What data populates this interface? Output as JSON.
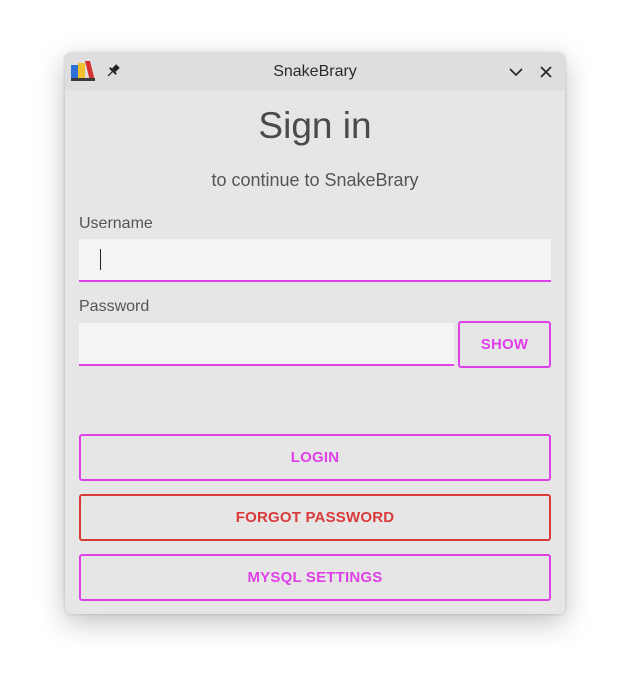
{
  "window": {
    "title": "SnakeBrary"
  },
  "signin": {
    "heading": "Sign in",
    "subheading": "to continue to SnakeBrary"
  },
  "username": {
    "label": "Username",
    "value": "",
    "placeholder": ""
  },
  "password": {
    "label": "Password",
    "value": "",
    "placeholder": "",
    "show_label": "SHOW"
  },
  "actions": {
    "login_label": "LOGIN",
    "forgot_label": "FORGOT PASSWORD",
    "mysql_label": "MYSQL SETTINGS"
  },
  "colors": {
    "accent": "#e040e8",
    "danger": "#d93a3a",
    "background": "#e6e6e6",
    "input_bg": "#f4f4f4"
  },
  "icons": {
    "app": "app-logo-icon",
    "pin": "pin-icon",
    "minimize": "chevron-down-icon",
    "close": "close-icon"
  }
}
